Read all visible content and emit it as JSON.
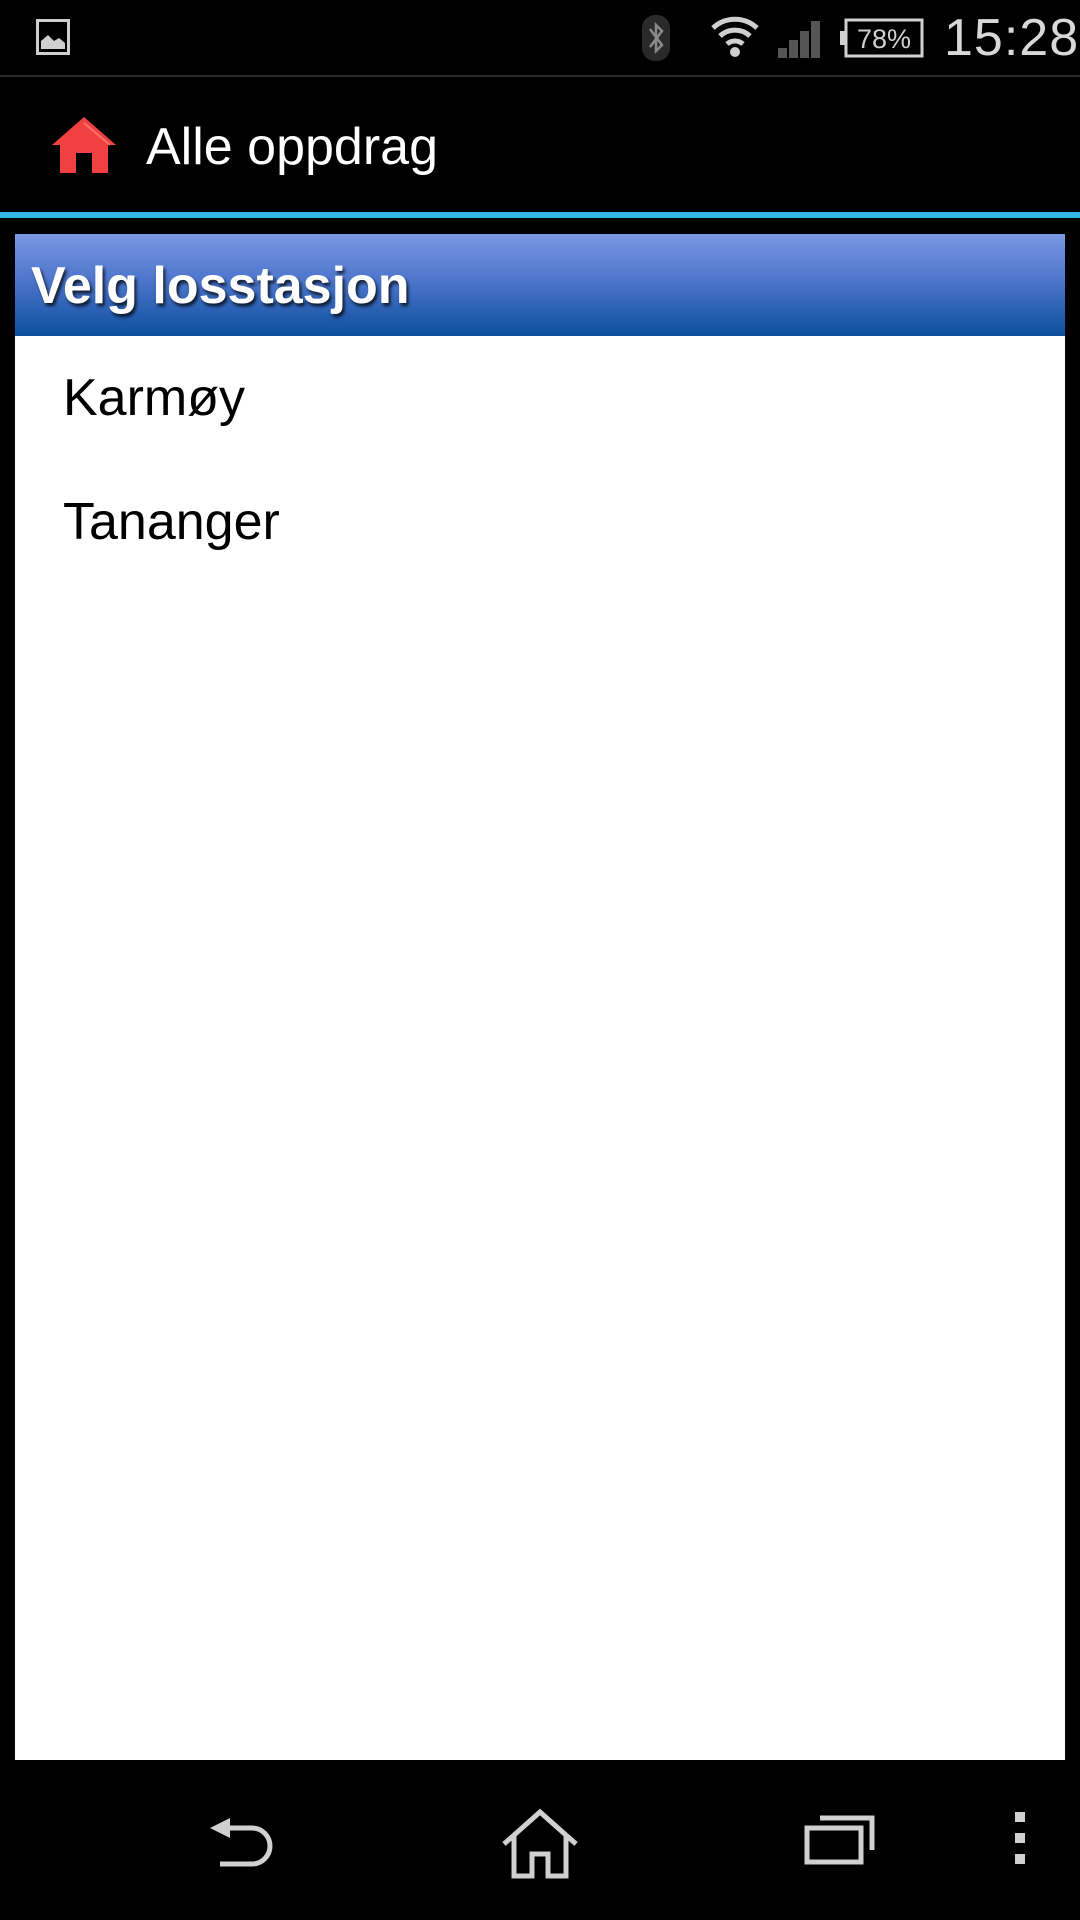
{
  "status_bar": {
    "time": "15:28",
    "battery_percent": "78%",
    "icons": [
      "gallery-notification-icon",
      "bluetooth-icon",
      "wifi-icon",
      "signal-icon",
      "battery-icon"
    ]
  },
  "action_bar": {
    "title": "Alle oppdrag",
    "home_icon_color": "#f04040",
    "accent_color": "#33b5e5"
  },
  "dialog": {
    "title": "Velg losstasjon",
    "items": [
      {
        "label": "Karmøy"
      },
      {
        "label": "Tananger"
      }
    ]
  },
  "nav_bar": {
    "buttons": [
      "back-icon",
      "home-icon",
      "recent-apps-icon",
      "overflow-menu-icon"
    ]
  }
}
